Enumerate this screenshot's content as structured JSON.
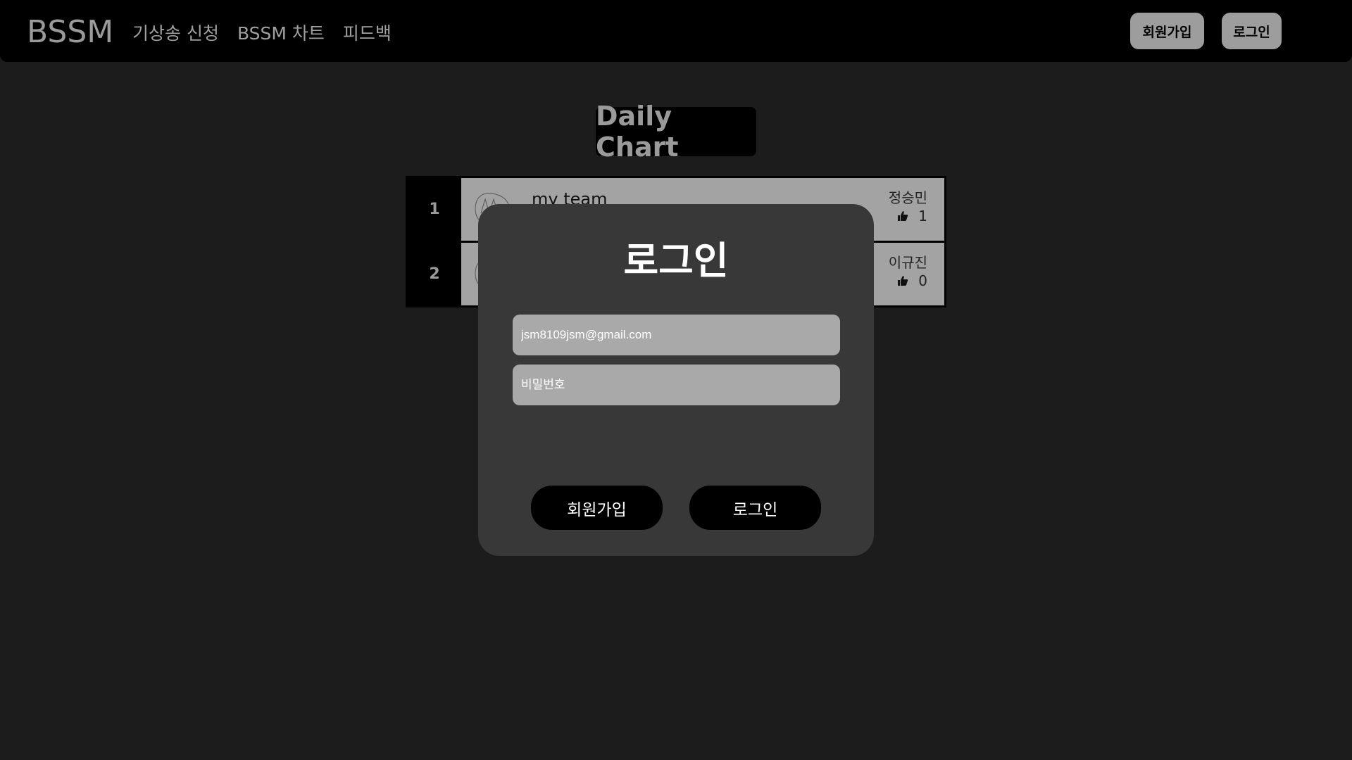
{
  "header": {
    "logo": "BSSM",
    "nav": [
      {
        "label": "기상송 신청"
      },
      {
        "label": "BSSM 차트"
      },
      {
        "label": "피드백"
      }
    ],
    "signup_label": "회원가입",
    "login_label": "로그인"
  },
  "chart": {
    "title": "Daily Chart",
    "rows": [
      {
        "rank": "1",
        "song": "my team",
        "requester": "정승민",
        "likes": "1"
      },
      {
        "rank": "2",
        "song": "",
        "requester": "이규진",
        "likes": "0"
      }
    ]
  },
  "modal": {
    "title": "로그인",
    "email_value": "jsm8109jsm@gmail.com",
    "password_placeholder": "비밀번호",
    "signup_label": "회원가입",
    "login_label": "로그인"
  },
  "colors": {
    "background": "#1c1c1c",
    "header": "#000000",
    "modal": "#383838",
    "accent": "#c2185b"
  }
}
